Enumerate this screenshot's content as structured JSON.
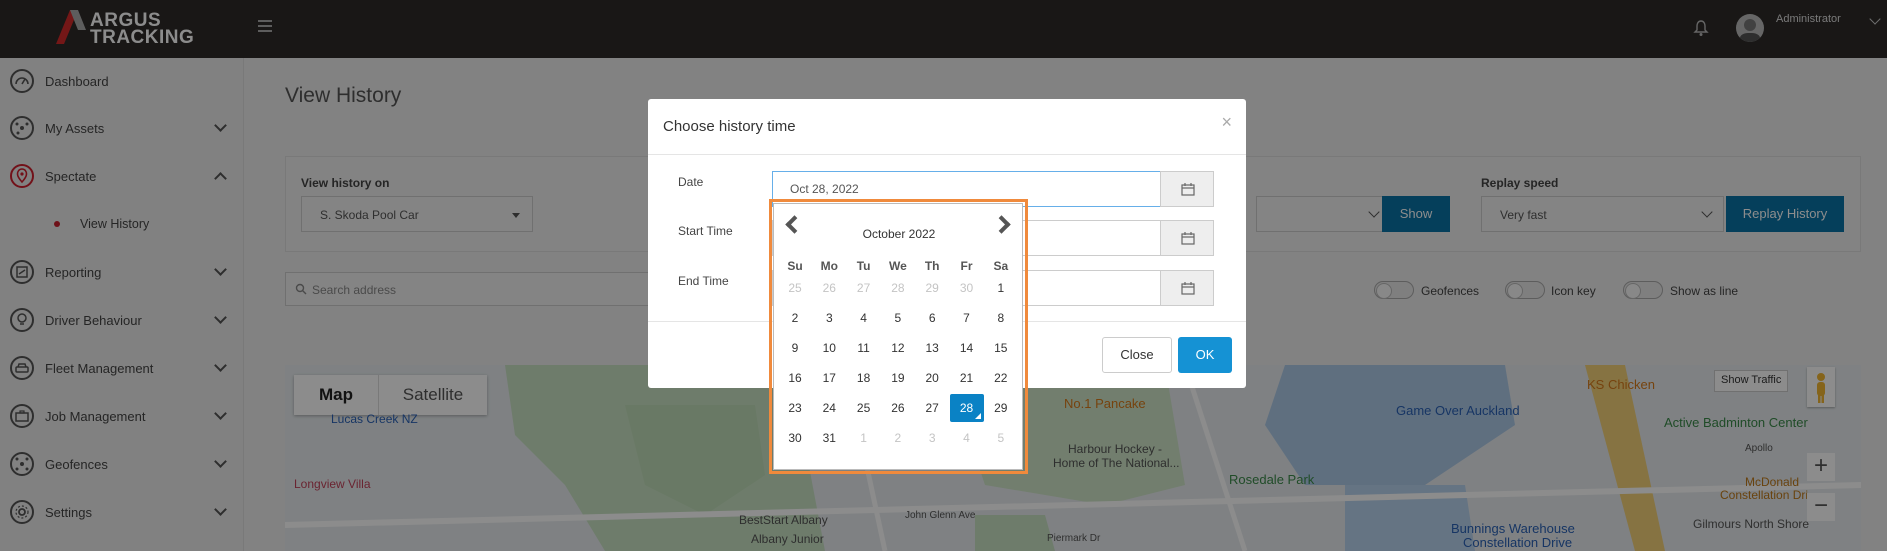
{
  "topbar": {
    "brand_line1": "ARGUS",
    "brand_line2": "TRACKING",
    "user_name": "Administrator"
  },
  "sidebar": {
    "items": [
      {
        "label": "Dashboard"
      },
      {
        "label": "My Assets"
      },
      {
        "label": "Spectate"
      },
      {
        "label": "Reporting"
      },
      {
        "label": "Driver Behaviour"
      },
      {
        "label": "Fleet Management"
      },
      {
        "label": "Job Management"
      },
      {
        "label": "Geofences"
      },
      {
        "label": "Settings"
      }
    ],
    "sub_item": "View History"
  },
  "page": {
    "title": "View History",
    "view_history_on_label": "View history on",
    "vehicle_value": "S. Skoda Pool Car",
    "show_button": "Show",
    "replay_speed_label": "Replay speed",
    "replay_speed_value": "Very fast",
    "replay_button": "Replay History",
    "search_placeholder": "Search address",
    "toggles": [
      "Geofences",
      "Icon key",
      "Show as line"
    ]
  },
  "map": {
    "tab_map": "Map",
    "tab_satellite": "Satellite",
    "show_traffic": "Show Traffic",
    "zoom_in": "+",
    "zoom_out": "−",
    "labels": [
      "Lucas Creek NZ",
      "Longview Villa",
      "No.1 Pancake",
      "Harbour Hockey -",
      "Home of The National...",
      "Rosedale Park",
      "Game Over Auckland",
      "KS Chicken",
      "Active Badminton Center",
      "McDonald",
      "Constellation Dri",
      "Bunnings Warehouse",
      "Constellation Drive",
      "Gilmours North Shore",
      "BestStart Albany",
      "Albany Junior",
      "John Glenn Ave",
      "Piermark Dr",
      "Apollo"
    ]
  },
  "modal": {
    "title": "Choose history time",
    "close_x": "×",
    "date_label": "Date",
    "date_value": "Oct 28, 2022",
    "start_label": "Start Time",
    "end_label": "End Time",
    "close_button": "Close",
    "ok_button": "OK"
  },
  "datepicker": {
    "month_label": "October 2022",
    "weekdays": [
      "Su",
      "Mo",
      "Tu",
      "We",
      "Th",
      "Fr",
      "Sa"
    ],
    "weeks": [
      [
        "25",
        "26",
        "27",
        "28",
        "29",
        "30",
        "1"
      ],
      [
        "2",
        "3",
        "4",
        "5",
        "6",
        "7",
        "8"
      ],
      [
        "9",
        "10",
        "11",
        "12",
        "13",
        "14",
        "15"
      ],
      [
        "16",
        "17",
        "18",
        "19",
        "20",
        "21",
        "22"
      ],
      [
        "23",
        "24",
        "25",
        "26",
        "27",
        "28",
        "29"
      ],
      [
        "30",
        "31",
        "1",
        "2",
        "3",
        "4",
        "5"
      ]
    ],
    "selected_day": "28"
  },
  "colors": {
    "topbar": "#2e2b29",
    "primary_button": "#0a73a7",
    "selected_day": "#0a82c5",
    "highlight_border": "#f08a3c",
    "spectate_accent": "#d0202e"
  }
}
